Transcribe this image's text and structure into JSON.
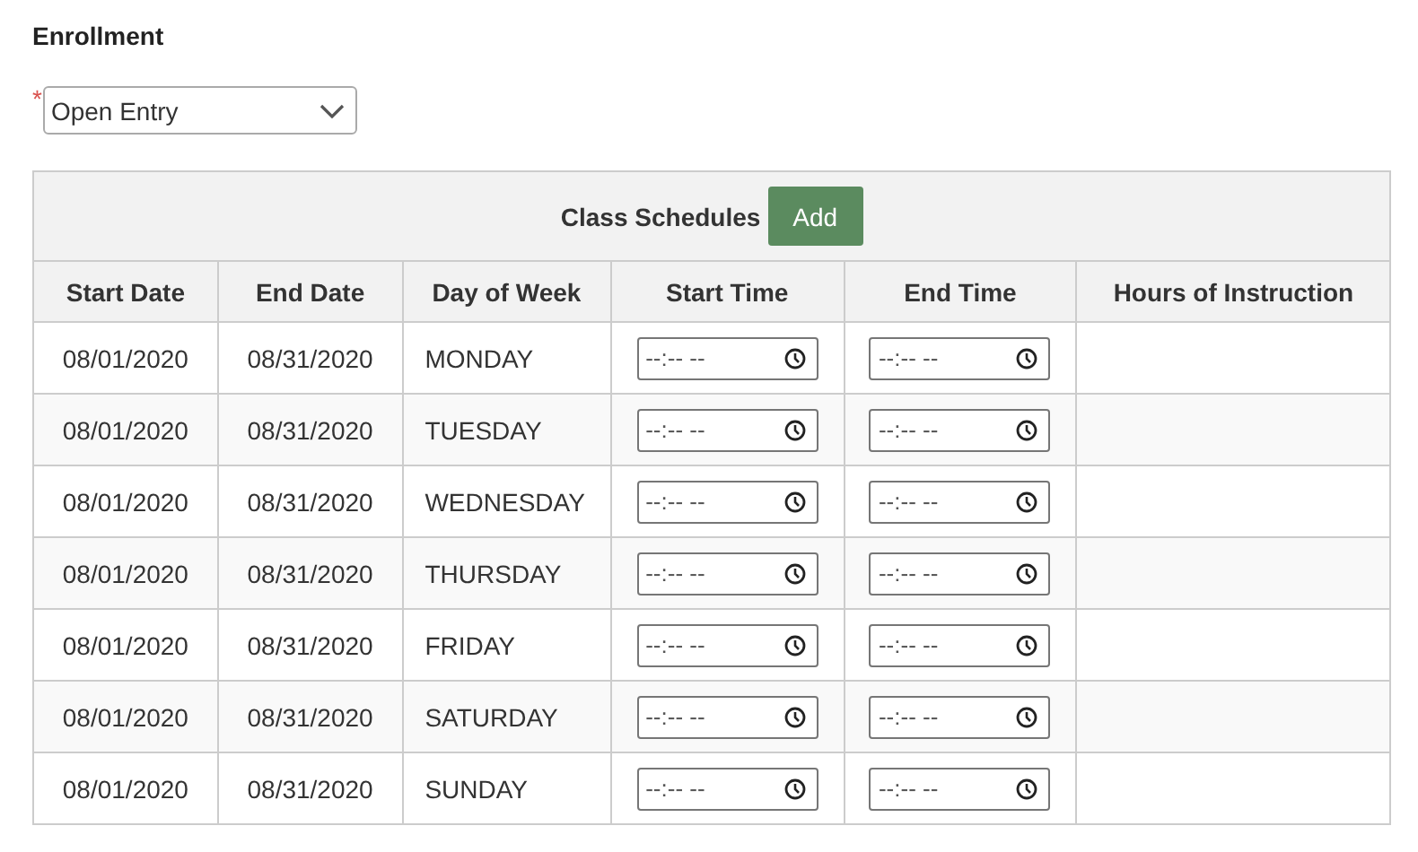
{
  "section_title": "Enrollment",
  "enrollment_type": {
    "required_mark": "*",
    "value": "Open Entry"
  },
  "table": {
    "caption": "Class Schedules",
    "add_button": "Add",
    "columns": [
      "Start Date",
      "End Date",
      "Day of Week",
      "Start Time",
      "End Time",
      "Hours of Instruction"
    ],
    "rows": [
      {
        "start_date": "08/01/2020",
        "end_date": "08/31/2020",
        "day": "MONDAY",
        "start_time": {
          "placeholder": "--:-- --"
        },
        "end_time": {
          "placeholder": "--:-- --"
        }
      },
      {
        "start_date": "08/01/2020",
        "end_date": "08/31/2020",
        "day": "TUESDAY",
        "start_time": {
          "placeholder": "--:-- --"
        },
        "end_time": {
          "placeholder": "--:-- --"
        }
      },
      {
        "start_date": "08/01/2020",
        "end_date": "08/31/2020",
        "day": "WEDNESDAY",
        "start_time": {
          "placeholder": "--:-- --"
        },
        "end_time": {
          "placeholder": "--:-- --"
        }
      },
      {
        "start_date": "08/01/2020",
        "end_date": "08/31/2020",
        "day": "THURSDAY",
        "start_time": {
          "placeholder": "--:-- --"
        },
        "end_time": {
          "placeholder": "--:-- --"
        }
      },
      {
        "start_date": "08/01/2020",
        "end_date": "08/31/2020",
        "day": "FRIDAY",
        "start_time": {
          "placeholder": "--:-- --"
        },
        "end_time": {
          "placeholder": "--:-- --"
        }
      },
      {
        "start_date": "08/01/2020",
        "end_date": "08/31/2020",
        "day": "SATURDAY",
        "start_time": {
          "placeholder": "--:-- --"
        },
        "end_time": {
          "placeholder": "--:-- --"
        }
      },
      {
        "start_date": "08/01/2020",
        "end_date": "08/31/2020",
        "day": "SUNDAY",
        "start_time": {
          "placeholder": "--:-- --"
        },
        "end_time": {
          "placeholder": "--:-- --"
        }
      }
    ]
  }
}
